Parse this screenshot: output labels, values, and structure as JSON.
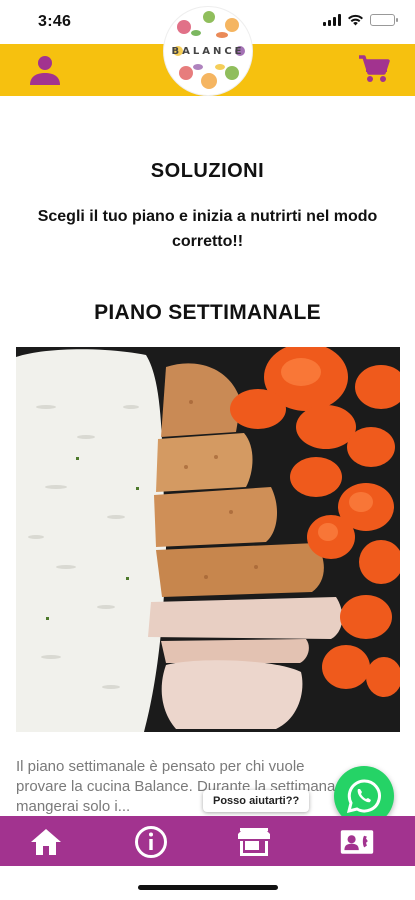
{
  "status_bar": {
    "time": "3:46"
  },
  "header": {
    "logo_text": "BALANCE",
    "brand_color": "#f6c10f",
    "icon_color": "#a2338f",
    "left_icon": "person-icon",
    "right_icon": "cart-icon"
  },
  "main": {
    "solutions_title": "SOLUZIONI",
    "subtitle": "Scegli il tuo piano e inizia a nutrirti nel modo corretto!!",
    "plan_title": "PIANO SETTIMANALE",
    "plan_image_icon": "rice-chicken-carrots-photo",
    "plan_description": "Il piano settimanale è pensato per chi vuole provare la cucina Balance. Durante la settimana mangerai solo i..."
  },
  "chat": {
    "help_label": "Posso aiutarti??",
    "whatsapp_icon": "whatsapp-icon",
    "whatsapp_color": "#25d366"
  },
  "bottom_nav": {
    "color": "#a2338f",
    "items": [
      {
        "icon": "home-icon"
      },
      {
        "icon": "info-icon"
      },
      {
        "icon": "store-icon"
      },
      {
        "icon": "contacts-icon"
      }
    ]
  }
}
